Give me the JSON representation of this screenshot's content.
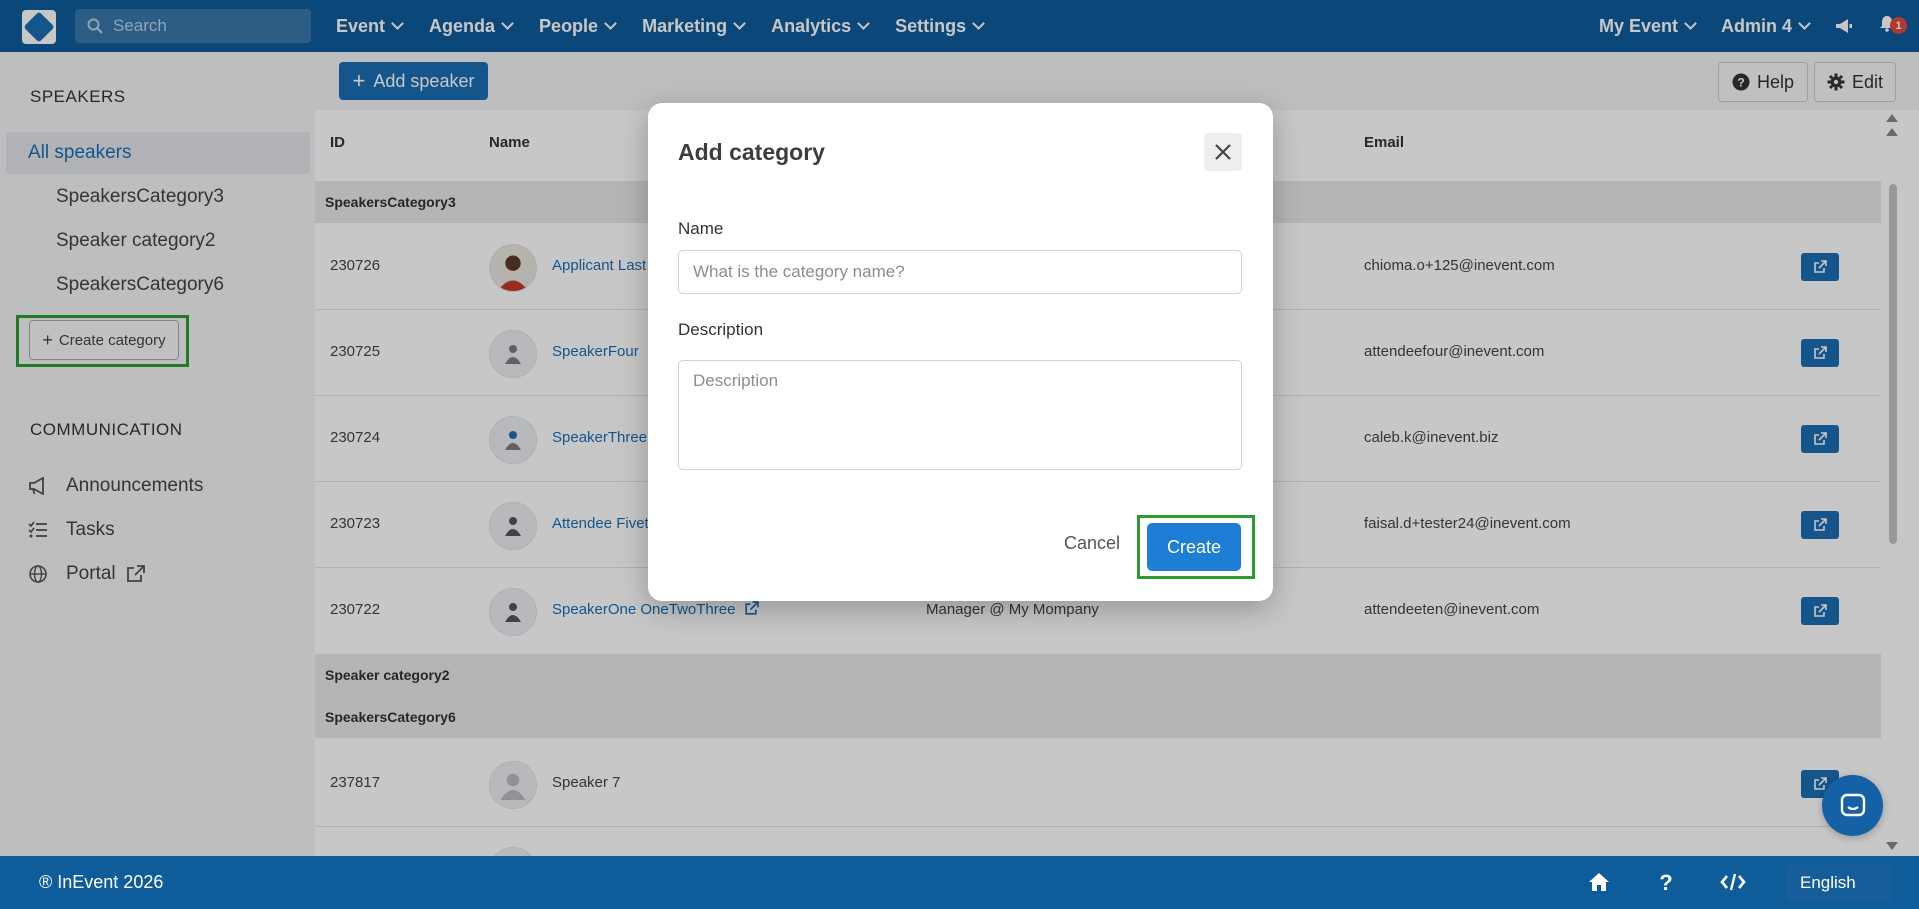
{
  "topnav": {
    "search_placeholder": "Search",
    "menu": [
      "Event",
      "Agenda",
      "People",
      "Marketing",
      "Analytics",
      "Settings"
    ],
    "my_event": "My Event",
    "admin": "Admin 4",
    "notification_count": "1"
  },
  "sidebar": {
    "speakers_heading": "SPEAKERS",
    "all_speakers": "All speakers",
    "categories": [
      "SpeakersCategory3",
      "Speaker category2",
      "SpeakersCategory6"
    ],
    "create_category": "Create category",
    "communication_heading": "COMMUNICATION",
    "communication_items": [
      "Announcements",
      "Tasks",
      "Portal"
    ]
  },
  "toolbar": {
    "add_speaker": "Add speaker",
    "help": "Help",
    "edit": "Edit"
  },
  "table": {
    "headers": {
      "id": "ID",
      "name": "Name",
      "email": "Email"
    },
    "group1": "SpeakersCategory3",
    "rows": [
      {
        "id": "230726",
        "name": "Applicant Last",
        "role": "",
        "email": "chioma.o+125@inevent.com"
      },
      {
        "id": "230725",
        "name": "SpeakerFour",
        "role": "",
        "email": "attendeefour@inevent.com"
      },
      {
        "id": "230724",
        "name": "SpeakerThree",
        "role": "",
        "email": "caleb.k@inevent.biz"
      },
      {
        "id": "230723",
        "name": "Attendee Fivet",
        "role": "",
        "email": "faisal.d+tester24@inevent.com"
      },
      {
        "id": "230722",
        "name": "SpeakerOne OneTwoThree",
        "role": "Manager @ My Mompany",
        "email": "attendeeten@inevent.com"
      }
    ],
    "group2": "Speaker category2",
    "group3": "SpeakersCategory6",
    "rows2": [
      {
        "id": "237817",
        "name": "Speaker 7",
        "email": ""
      }
    ]
  },
  "modal": {
    "title": "Add category",
    "name_label": "Name",
    "name_placeholder": "What is the category name?",
    "description_label": "Description",
    "description_placeholder": "Description",
    "cancel": "Cancel",
    "create": "Create"
  },
  "footer": {
    "copyright": "® InEvent 2026",
    "language": "English"
  },
  "colors": {
    "brand": "#0f5c9a",
    "primary_button": "#1e7ed6",
    "highlight_frame": "#2d9b2f",
    "badge": "#e04b3f"
  }
}
